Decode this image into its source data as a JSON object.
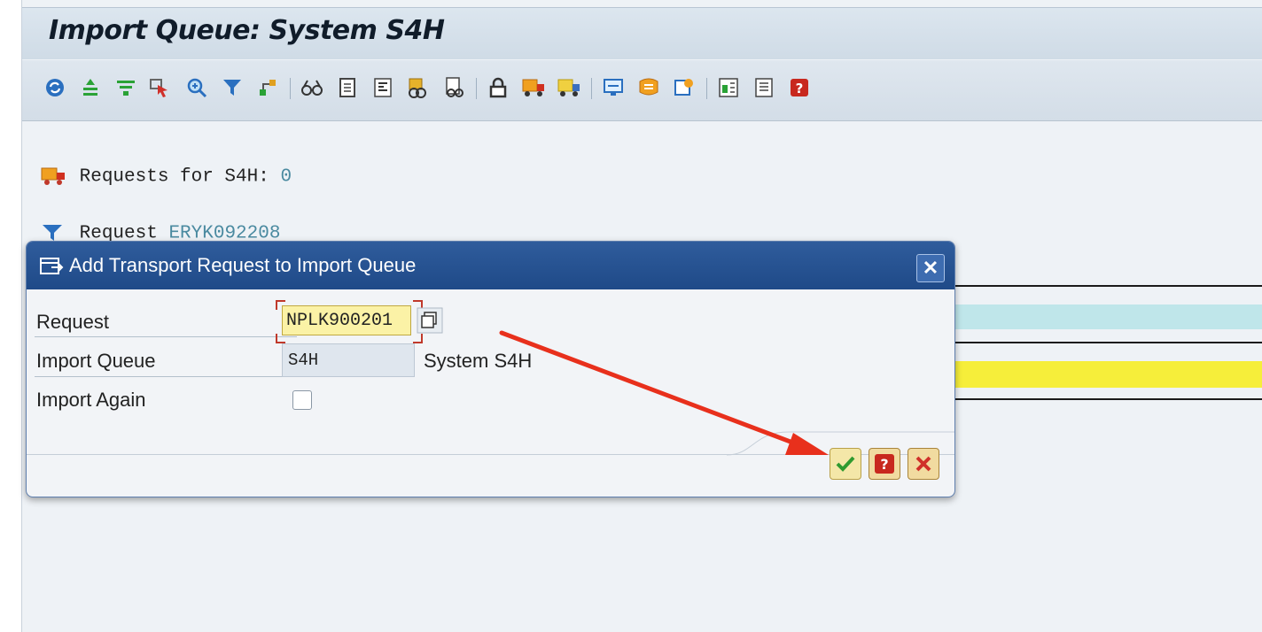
{
  "window": {
    "title": "Import Queue: System S4H"
  },
  "toolbar": {
    "icons": [
      "refresh-icon",
      "expand-icon",
      "filter-list-icon",
      "select-icon",
      "zoom-icon",
      "filter-icon",
      "tree-icon",
      "glasses-icon",
      "document-icon",
      "text-icon",
      "request-display-icon",
      "binoculars-icon",
      "lock-icon",
      "truck-import-icon",
      "truck-all-icon",
      "monitor-icon",
      "paste-icon",
      "settings-icon",
      "details-icon",
      "list-icon",
      "help-icon"
    ]
  },
  "content": {
    "requests_label": "Requests for S4H:",
    "requests_count": "0",
    "request_label": "Request",
    "request_value": "ERYK092208"
  },
  "dialog": {
    "title": "Add Transport Request to Import Queue",
    "request_label": "Request",
    "request_value": "NPLK900201",
    "import_queue_label": "Import Queue",
    "import_queue_value": "S4H",
    "system_text": "System S4H",
    "import_again_label": "Import Again",
    "import_again_checked": false
  },
  "colors": {
    "annotation_arrow": "#e8301c",
    "dialog_header": "#1f4a88",
    "yellow_band": "#f6ee3a",
    "cyan_band": "#bfe6ea"
  }
}
